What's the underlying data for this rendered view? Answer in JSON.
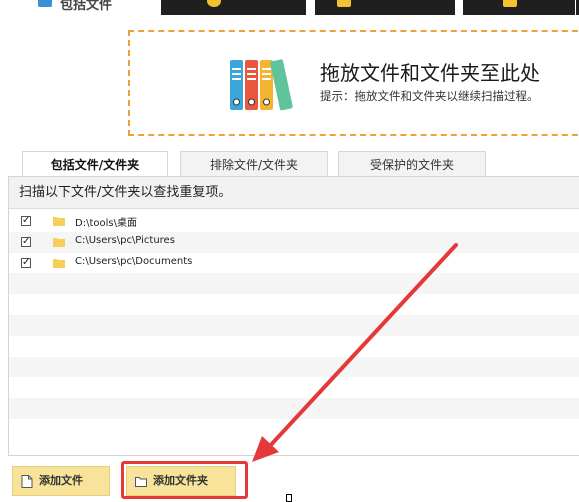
{
  "top_tabs": [
    {
      "label": "包括文件",
      "active": true
    },
    {
      "label": "",
      "active": false
    },
    {
      "label": "",
      "active": false
    },
    {
      "label": "",
      "active": false
    }
  ],
  "dropzone": {
    "title": "拖放文件和文件夹至此处",
    "tip": "提示：拖放文件和文件夹以继续扫描过程。",
    "icon": "binders-icon",
    "border_color": "#f0a03a"
  },
  "tabs": [
    {
      "label": "包括文件/文件夹",
      "active": true
    },
    {
      "label": "排除文件/文件夹",
      "active": false
    },
    {
      "label": "受保护的文件夹",
      "active": false
    }
  ],
  "panel": {
    "header": "扫描以下文件/文件夹以查找重复项。",
    "items": [
      {
        "checked": true,
        "path": "D:\\tools\\桌面"
      },
      {
        "checked": true,
        "path": "C:\\Users\\pc\\Pictures"
      },
      {
        "checked": true,
        "path": "C:\\Users\\pc\\Documents"
      }
    ]
  },
  "buttons": {
    "add_file": "添加文件",
    "add_folder": "添加文件夹"
  },
  "colors": {
    "accent_button": "#f8e39a",
    "highlight": "#e53939",
    "folder": "#f5cf5a"
  }
}
